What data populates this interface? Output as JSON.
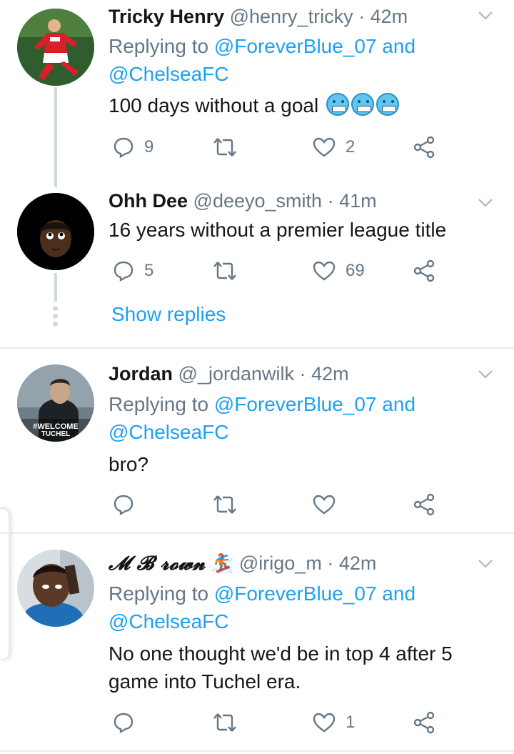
{
  "tweets": [
    {
      "name": "Tricky Henry",
      "handle": "@henry_tricky",
      "time": "42m",
      "replying_prefix": "Replying to ",
      "replying_mention1": "@ForeverBlue_07",
      "replying_and": " and",
      "replying_mention2": "@ChelseaFC",
      "text": "100 days without a goal",
      "emoji": [
        "cold-face",
        "cold-face",
        "cold-face"
      ],
      "reply_count": "9",
      "retweet_count": "",
      "like_count": "2"
    },
    {
      "name": "Ohh Dee",
      "handle": "@deeyo_smith",
      "time": "41m",
      "text": "16 years without a premier league title",
      "reply_count": "5",
      "retweet_count": "",
      "like_count": "69"
    },
    {
      "name": "Jordan",
      "handle": "@_jordanwilk",
      "time": "42m",
      "replying_prefix": "Replying to ",
      "replying_mention1": "@ForeverBlue_07",
      "replying_and": " and",
      "replying_mention2": "@ChelseaFC",
      "text": "bro?",
      "avatar_caption_line1": "#WELCOME",
      "avatar_caption_line2": "TUCHEL",
      "reply_count": "",
      "retweet_count": "",
      "like_count": ""
    },
    {
      "name": "𝓜 𝓑 𝓻𝓸𝔀𝓷",
      "name_emoji": "snowboarder",
      "handle": "@irigo_m",
      "time": "42m",
      "replying_prefix": "Replying to ",
      "replying_mention1": "@ForeverBlue_07",
      "replying_and": " and",
      "replying_mention2": "@ChelseaFC",
      "text_line1": "No one thought we'd be in top 4 after 5",
      "text_line2": "game into Tuchel era.",
      "reply_count": "",
      "retweet_count": "",
      "like_count": "1"
    }
  ],
  "show_replies": "Show replies",
  "separator": "·",
  "colors": {
    "link": "#1da1f2",
    "secondary": "#657786",
    "thread_line": "#cfd9de"
  }
}
